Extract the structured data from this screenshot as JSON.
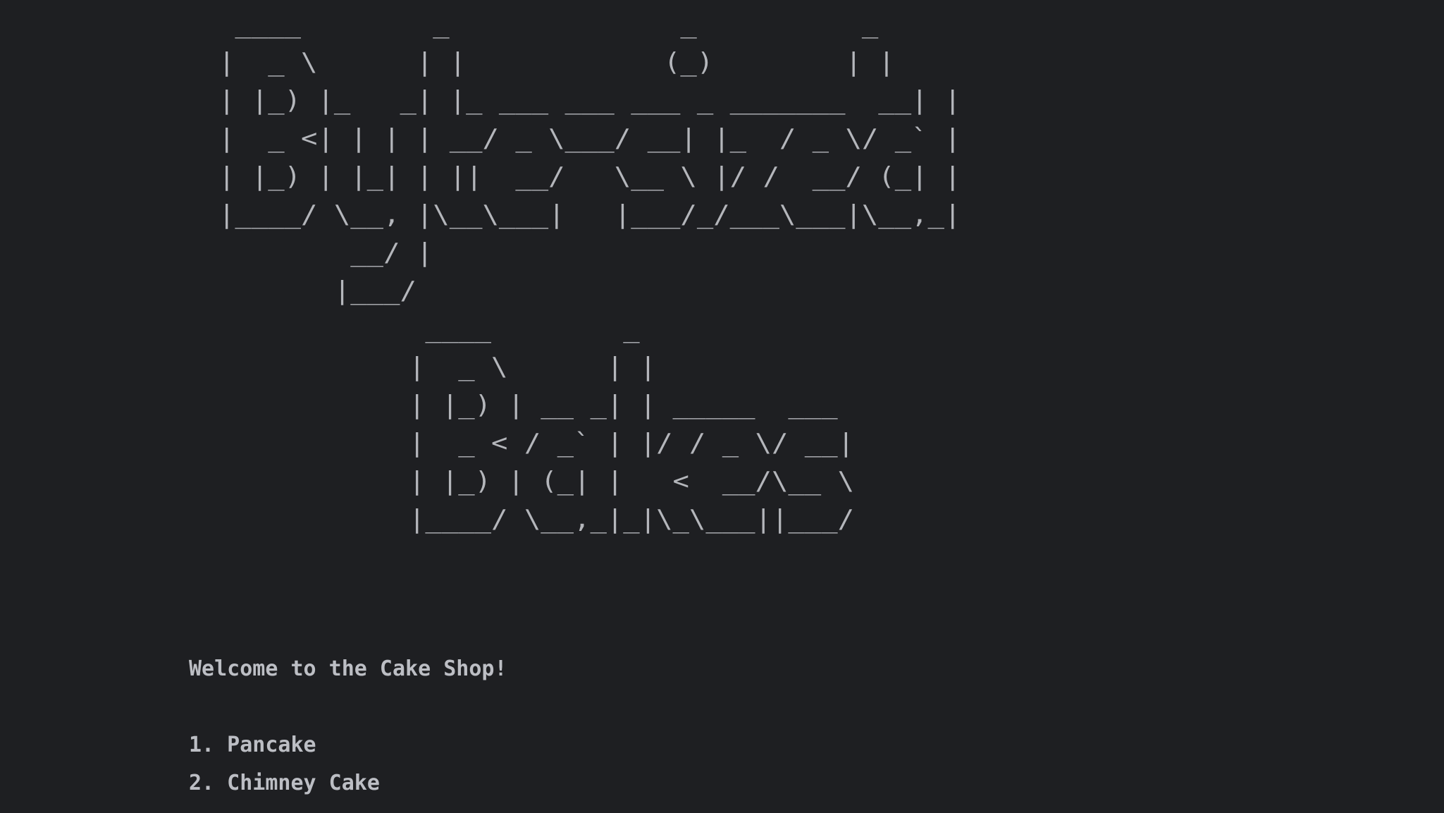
{
  "banner": {
    "line1": "Byte-Sized",
    "line2": "Bakes",
    "ascii_top": " ____        _              _          _ \n|  _ \\      | |            (_)        | |\n| |_) |_   _| |_ ___ ___ ___ _ _______  __| |\n|  _ <| | | | __/ _ \\___/ __| |_  / _ \\/ _` |\n| |_) | |_| | ||  __/   \\__ \\ |/ /  __/ (_| |\n|____/ \\__, |\\__\\___|   |___/_/___\\___|\\__,_|\n        __/ |\n       |___/",
    "ascii_bottom": " ____        _\n|  _ \\      | |\n| |_) | __ _| | _____  ___\n|  _ < / _` | |/ / _ \\/ __|\n| |_) | (_| |   <  __/\\__ \\\n|____/ \\__,_|_|\\_\\___||___/"
  },
  "welcome_text": "Welcome to the Cake Shop!",
  "menu_items": [
    {
      "label": "1. Pancake"
    },
    {
      "label": "2. Chimney Cake"
    }
  ]
}
